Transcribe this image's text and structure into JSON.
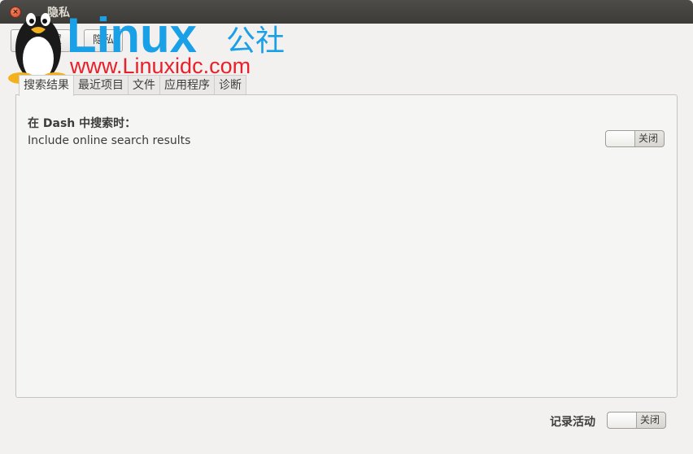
{
  "window": {
    "title": "隐私",
    "close_glyph": "×"
  },
  "toolbar": {
    "all_settings_label": "全部设置",
    "privacy_label": "隐私"
  },
  "watermark": {
    "brand": "Linux",
    "brand_suffix": "公社",
    "url": "www.Linuxidc.com"
  },
  "tabs": [
    {
      "label": "搜索结果",
      "active": true
    },
    {
      "label": "最近项目",
      "active": false
    },
    {
      "label": "文件",
      "active": false
    },
    {
      "label": "应用程序",
      "active": false
    },
    {
      "label": "诊断",
      "active": false
    }
  ],
  "search_results": {
    "heading": "在 Dash 中搜索时：",
    "online_label": "Include online search results",
    "online_switch_state": "关闭"
  },
  "footer": {
    "record_activity_label": "记录活动",
    "record_activity_state": "关闭"
  },
  "colors": {
    "brand_blue": "#1aa0e6",
    "brand_red": "#e8202a",
    "titlebar": "#3c3b37",
    "close_button": "#d6452a"
  }
}
